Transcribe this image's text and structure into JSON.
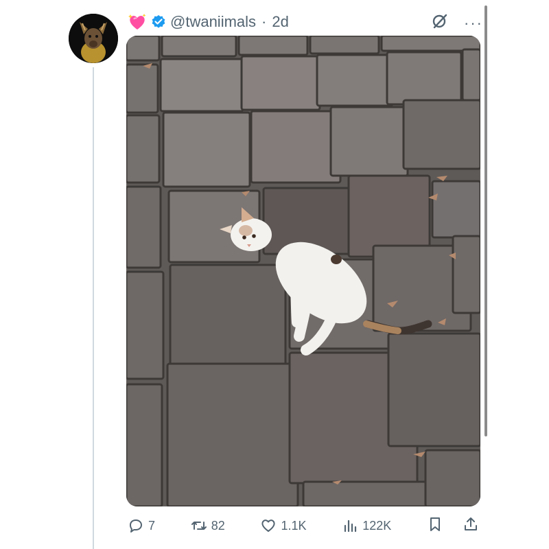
{
  "tweet": {
    "handle": "@twaniimals",
    "separator": "·",
    "time": "2d"
  },
  "icons": {
    "heart_emoji": "sparkling-heart-icon",
    "verified": "verified-badge-icon",
    "grok": "grok-icon",
    "more": "more-icon",
    "reply": "reply-icon",
    "retweet": "retweet-icon",
    "like": "like-icon",
    "views": "views-icon",
    "bookmark": "bookmark-icon",
    "share": "share-icon"
  },
  "actions": {
    "replies": "7",
    "retweets": "82",
    "likes": "1.1K",
    "views": "122K"
  },
  "colors": {
    "verified": "#1d9bf0",
    "muted": "#536471",
    "heart": "#ff4fa3"
  }
}
